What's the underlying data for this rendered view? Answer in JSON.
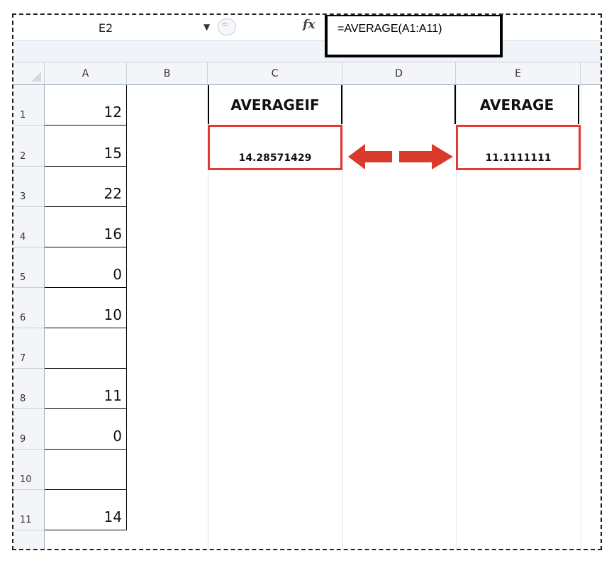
{
  "formula_bar": {
    "name_box": "E2",
    "fx_symbol": "fx",
    "formula": "=AVERAGE(A1:A11)"
  },
  "columns": [
    "A",
    "B",
    "C",
    "D",
    "E"
  ],
  "rows": [
    "1",
    "2",
    "3",
    "4",
    "5",
    "6",
    "7",
    "8",
    "9",
    "10",
    "11"
  ],
  "column_a_values": [
    "12",
    "15",
    "22",
    "16",
    "0",
    "10",
    "",
    "11",
    "0",
    "",
    "14"
  ],
  "averageif": {
    "header": "AVERAGEIF",
    "value": "14.28571429"
  },
  "average": {
    "header": "AVERAGE",
    "value": "11.1111111"
  },
  "colors": {
    "highlight": "#e53935",
    "arrow": "#d93a2b"
  }
}
